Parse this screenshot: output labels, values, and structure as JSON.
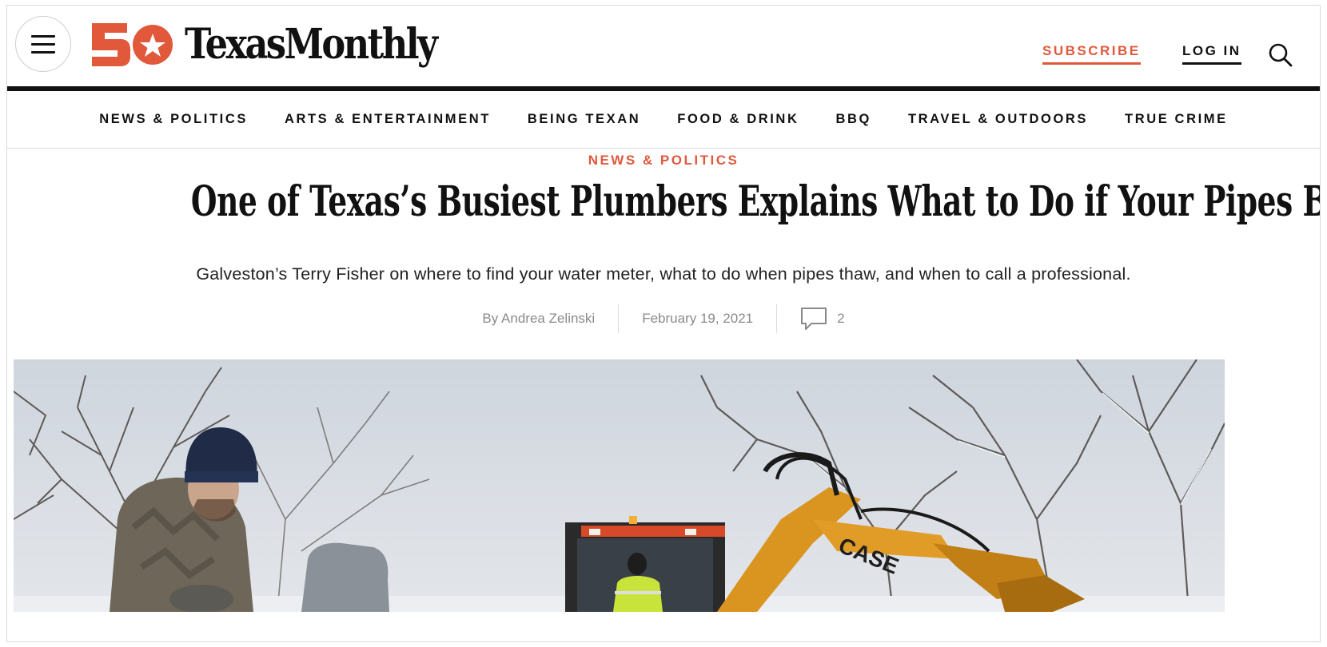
{
  "header": {
    "menu_icon": "hamburger-menu-icon",
    "logo_badge": "50",
    "logo_wordmark": "TexasMonthly",
    "subscribe_label": "SUBSCRIBE",
    "login_label": "LOG IN",
    "search_icon": "search-icon"
  },
  "nav": {
    "items": [
      {
        "label": "NEWS & POLITICS"
      },
      {
        "label": "ARTS & ENTERTAINMENT"
      },
      {
        "label": "BEING TEXAN"
      },
      {
        "label": "FOOD & DRINK"
      },
      {
        "label": "BBQ"
      },
      {
        "label": "TRAVEL & OUTDOORS"
      },
      {
        "label": "TRUE CRIME"
      }
    ]
  },
  "article": {
    "kicker": "NEWS & POLITICS",
    "headline": "One of Texas’s Busiest Plumbers Explains What to Do if Your Pipes Burst",
    "dek": "Galveston’s Terry Fisher on where to find your water meter, what to do when pipes thaw, and when to call a professional.",
    "byline": "By Andrea Zelinski",
    "date": "February 19, 2021",
    "comment_count": "2",
    "comment_icon": "comment-bubble-icon",
    "hero_caption_text": "CASE"
  },
  "colors": {
    "accent": "#e1583b",
    "text": "#111111",
    "muted": "#8a8a8a"
  }
}
